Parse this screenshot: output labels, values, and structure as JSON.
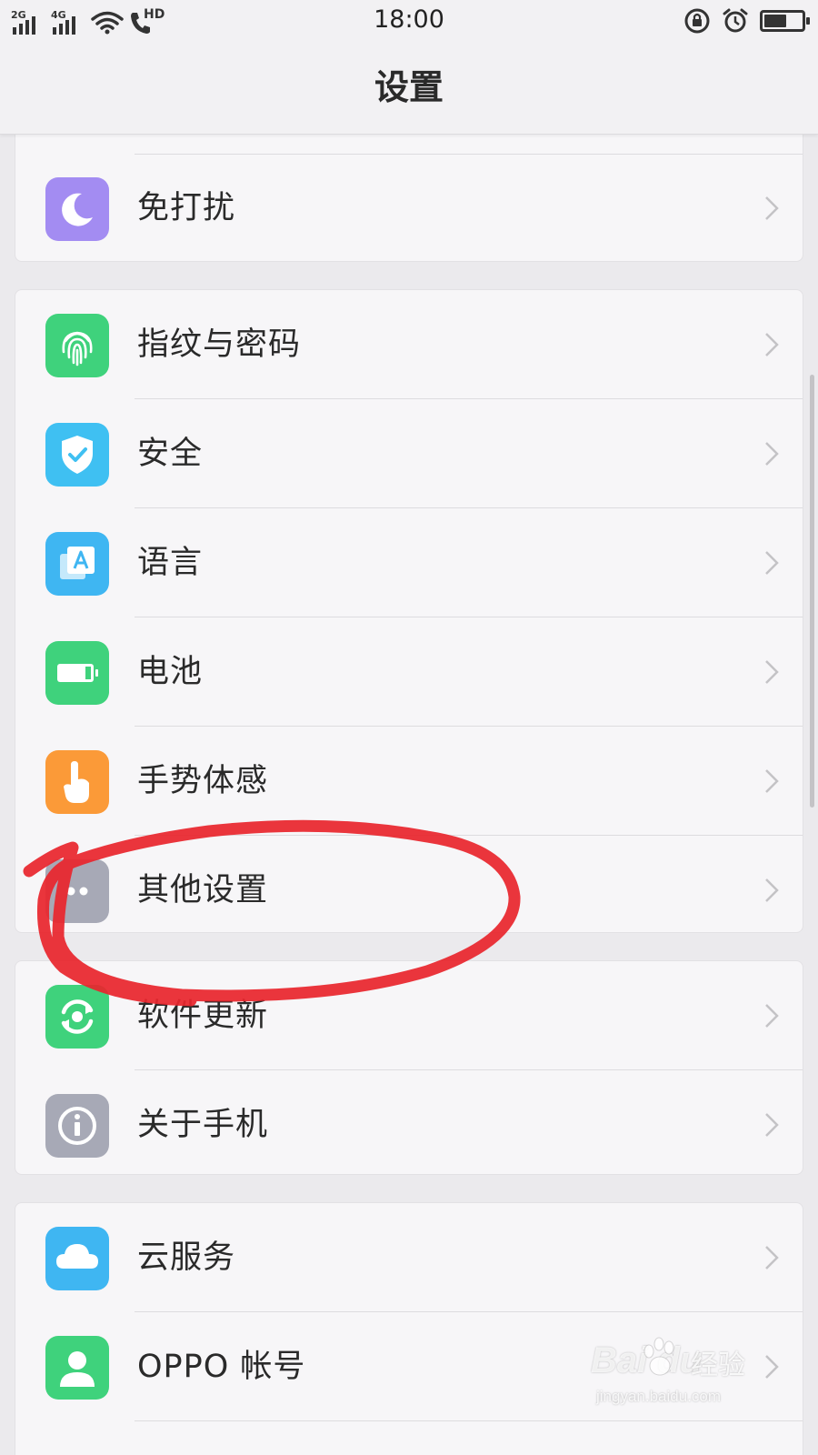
{
  "status_bar": {
    "time": "18:00",
    "network_1": "2G",
    "network_2": "4G",
    "hd": "HD",
    "battery_level": 0.6
  },
  "header": {
    "title": "设置"
  },
  "groups": [
    {
      "items": [
        {
          "label": "免打扰",
          "icon": "moon-icon",
          "color": "#a38cf2"
        }
      ]
    },
    {
      "items": [
        {
          "label": "指纹与密码",
          "icon": "fingerprint-icon",
          "color": "#3fd27c"
        },
        {
          "label": "安全",
          "icon": "shield-check-icon",
          "color": "#3fc0f2"
        },
        {
          "label": "语言",
          "icon": "language-icon",
          "color": "#3fb6f2"
        },
        {
          "label": "电池",
          "icon": "battery-icon",
          "color": "#3fd27c"
        },
        {
          "label": "手势体感",
          "icon": "hand-pointer-icon",
          "color": "#fb9a38"
        },
        {
          "label": "其他设置",
          "icon": "more-dots-icon",
          "color": "#a7a9b6"
        }
      ]
    },
    {
      "items": [
        {
          "label": "软件更新",
          "icon": "update-icon",
          "color": "#3fd27c"
        },
        {
          "label": "关于手机",
          "icon": "info-icon",
          "color": "#a7a9b6"
        }
      ]
    },
    {
      "items": [
        {
          "label": "云服务",
          "icon": "cloud-icon",
          "color": "#3fb6f2"
        },
        {
          "label": "OPPO 帐号",
          "icon": "account-icon",
          "color": "#3fd27c"
        }
      ]
    }
  ],
  "watermark": {
    "brand": "Bai du",
    "label": "经验",
    "url": "jingyan.baidu.com"
  }
}
